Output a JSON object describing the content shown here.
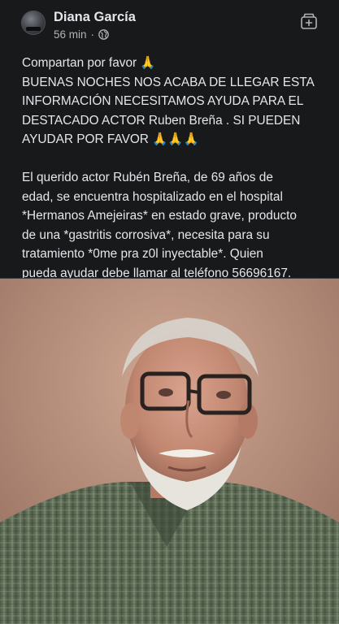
{
  "post": {
    "author": "Diana García",
    "time": "56 min",
    "separator": "·",
    "privacy_icon": "globe-icon",
    "action_icon": "archive-icon",
    "text_lines": [
      "Compartan por favor 🙏",
      "BUENAS NOCHES NOS ACABA DE LLEGAR ESTA",
      "INFORMACIÓN NECESITAMOS AYUDA PARA EL",
      "DESTACADO ACTOR Ruben Breña . SI PUEDEN",
      "AYUDAR POR FAVOR 🙏🙏🙏",
      "",
      "El querido actor Rubén Breña, de 69 años de",
      "edad, se encuentra hospitalizado en el hospital",
      "*Hermanos Amejeiras* en estado grave, producto",
      "de una *gastritis corrosiva*, necesita para su",
      "tratamiento *0me pra z0l inyectable*. Quien",
      "pueda ayudar debe llamar al teléfono 56696167."
    ]
  },
  "colors": {
    "background": "#18191a",
    "text_primary": "#e4e6eb",
    "text_secondary": "#b0b3b8"
  }
}
